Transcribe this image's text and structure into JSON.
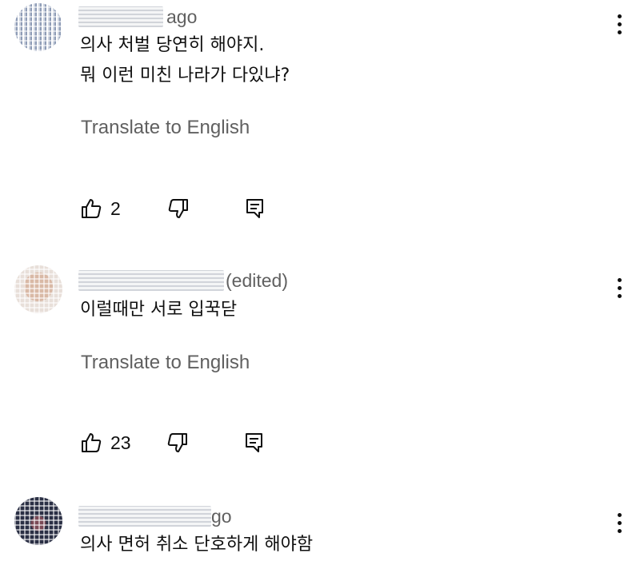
{
  "comments": [
    {
      "time_suffix": "ago",
      "body_lines": [
        "의사 처벌 당연히 해야지.",
        "뭐 이런 미친 나라가 다있냐?"
      ],
      "translate_label": "Translate to English",
      "like_count": "2"
    },
    {
      "time_suffix": "(edited)",
      "body_lines": [
        "이럴때만 서로 입꾹닫"
      ],
      "translate_label": "Translate to English",
      "like_count": "23"
    },
    {
      "time_suffix": "go",
      "body_lines": [
        "의사 면허 취소 단호하게 해야함"
      ]
    }
  ],
  "icons": {
    "like": "thumbs-up-icon",
    "dislike": "thumbs-down-icon",
    "reply": "reply-comment-icon",
    "more": "more-vertical-icon"
  }
}
